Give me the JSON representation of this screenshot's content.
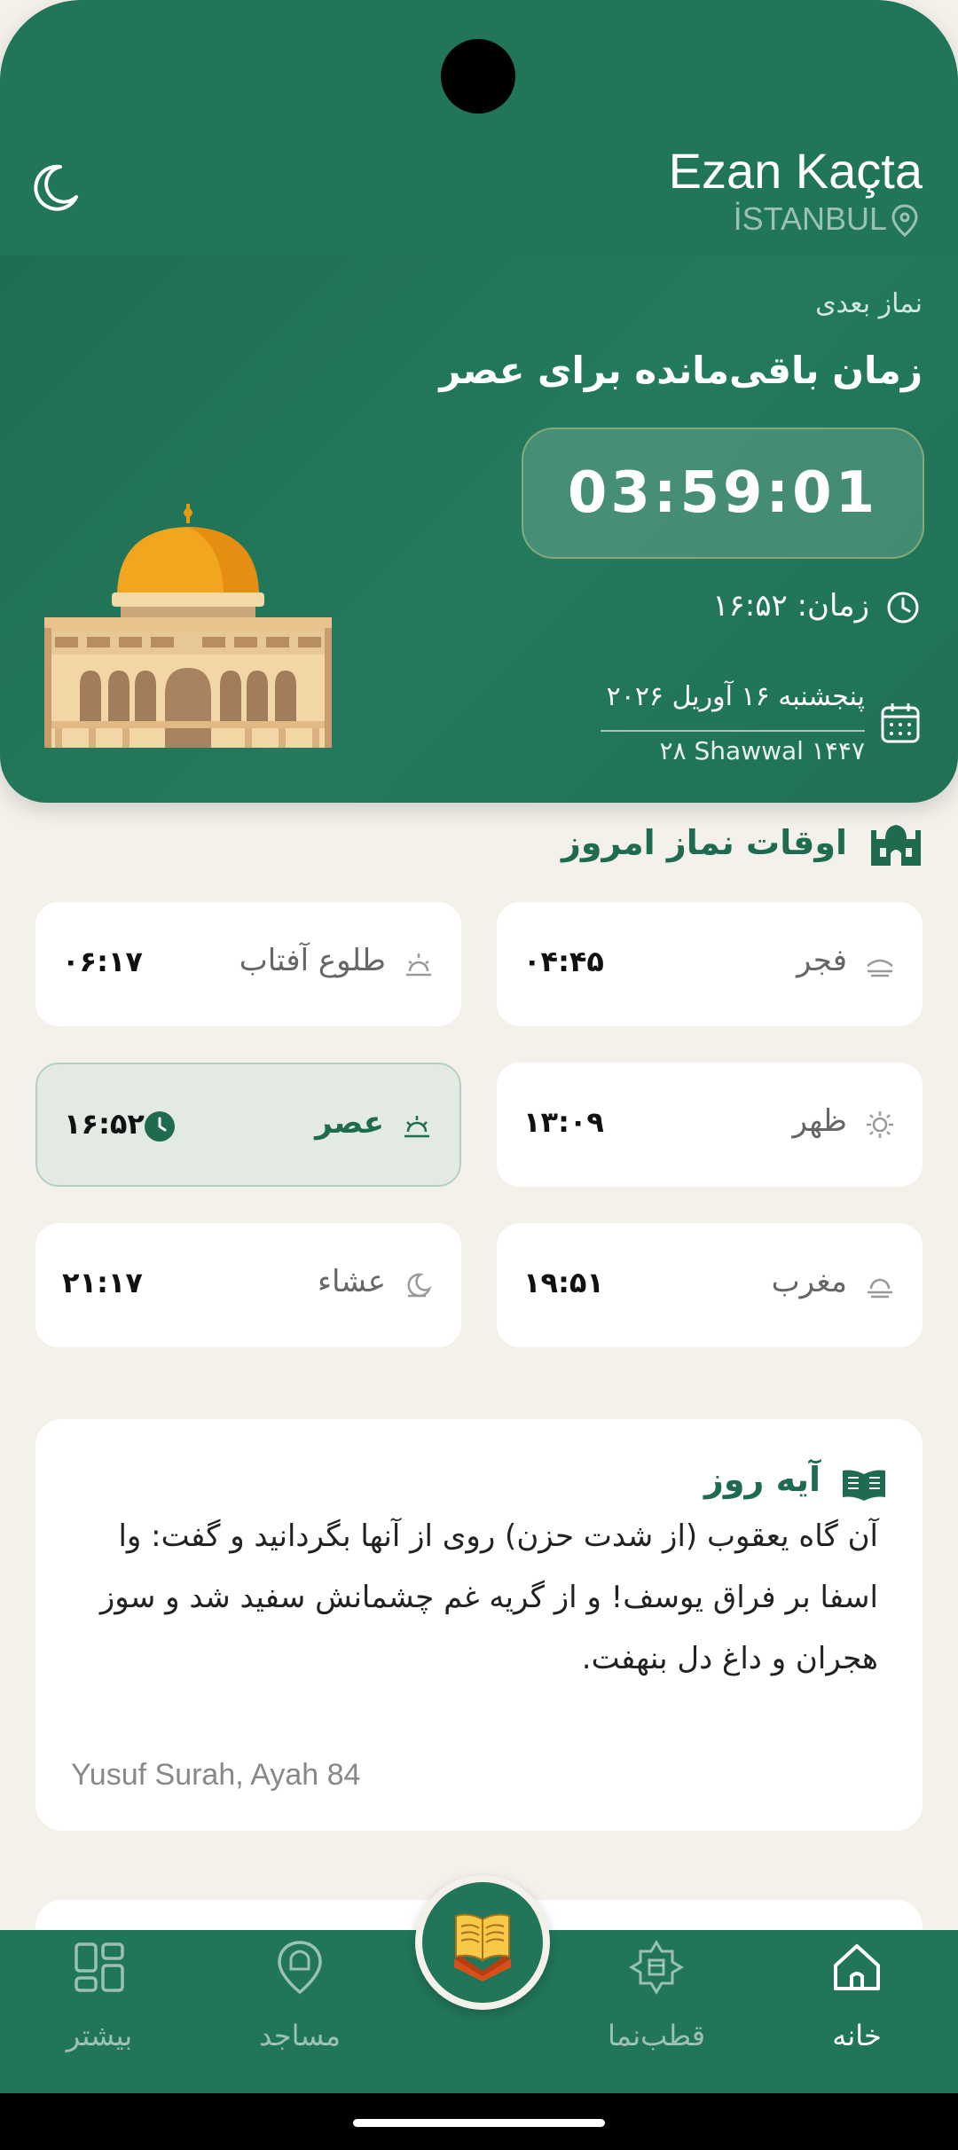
{
  "header": {
    "app_title": "Ezan Kaçta",
    "city": "İSTANBUL"
  },
  "hero": {
    "next_label": "نماز بعدی",
    "remaining_label": "زمان باقی‌مانده برای عصر",
    "countdown": "03:59:01",
    "time_text": "زمان: ۱۶:۵۲",
    "gregorian_date": "پنجشنبه ۱۶ آوریل ۲۰۲۶",
    "hijri_date": "۲۸ Shawwal ۱۴۴۷"
  },
  "prayers": {
    "section_title": "اوقات نماز امروز",
    "items": [
      {
        "name": "فجر",
        "time": "۰۴:۴۵",
        "icon": "dawn-icon"
      },
      {
        "name": "طلوع آفتاب",
        "time": "۰۶:۱۷",
        "icon": "sunrise-icon"
      },
      {
        "name": "ظهر",
        "time": "۱۳:۰۹",
        "icon": "sun-icon"
      },
      {
        "name": "عصر",
        "time": "۱۶:۵۲",
        "icon": "afternoon-icon",
        "active": true
      },
      {
        "name": "مغرب",
        "time": "۱۹:۵۱",
        "icon": "sunset-icon"
      },
      {
        "name": "عشاء",
        "time": "۲۱:۱۷",
        "icon": "night-icon"
      }
    ]
  },
  "ayah": {
    "title": "آیه روز",
    "text": "آن گاه یعقوب (از شدت حزن) روی از آنها بگردانید و گفت: وا اسفا بر فراق یوسف! و از گریه غم چشمانش سفید شد و سوز هجران و داغ دل بنهفت.",
    "reference": "Yusuf Surah, Ayah 84"
  },
  "nav": {
    "home": "خانه",
    "qibla": "قطب‌نما",
    "mosques": "مساجد",
    "more": "بیشتر"
  },
  "colors": {
    "primary": "#217559",
    "background": "#f4f1eb",
    "dome": "#f0a21c"
  }
}
